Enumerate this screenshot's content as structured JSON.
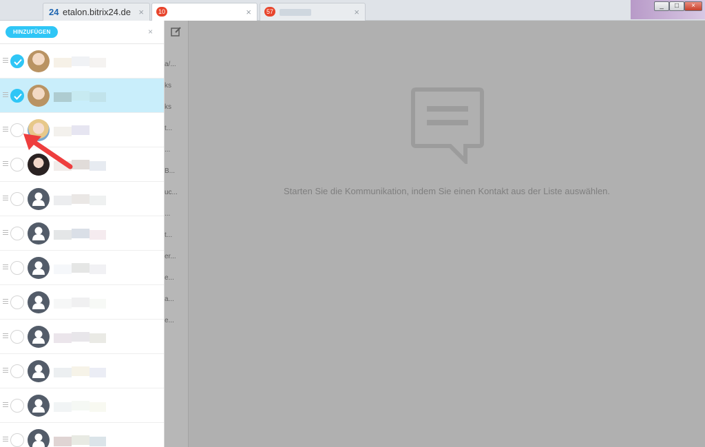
{
  "tabs": [
    {
      "logo": "24",
      "title": "etalon.bitrix24.de",
      "close": "×"
    },
    {
      "badge": "10",
      "title": "",
      "close": "×"
    },
    {
      "badge": "57",
      "title": "",
      "close": "×"
    }
  ],
  "window_controls": {
    "minimize": "_",
    "maximize": "□",
    "close": "×"
  },
  "picker": {
    "add_button": "HINZUFÜGEN",
    "close": "×",
    "contacts": [
      {
        "selected": true
      },
      {
        "selected": true
      },
      {
        "selected": false
      },
      {
        "selected": false
      },
      {
        "selected": false
      },
      {
        "selected": false
      },
      {
        "selected": false
      },
      {
        "selected": false
      },
      {
        "selected": false
      },
      {
        "selected": false
      },
      {
        "selected": false
      },
      {
        "selected": false
      }
    ]
  },
  "recent": {
    "snippets": [
      "a/...",
      "ks",
      "ks",
      "t...",
      "...",
      "B...",
      "uc...",
      "...",
      "t...",
      "er...",
      "e...",
      "a...",
      "e..."
    ]
  },
  "empty_state": {
    "message": "Starten Sie die Kommunikation, indem Sie einen Kontakt aus der Liste auswählen."
  },
  "colors": {
    "accent": "#2fc6f6",
    "badge": "#e8452c",
    "overlay": "#b0b0b0"
  },
  "icons": {
    "compose": "edit-icon",
    "chat": "chat-bubble-icon",
    "avatar": "user-icon"
  }
}
